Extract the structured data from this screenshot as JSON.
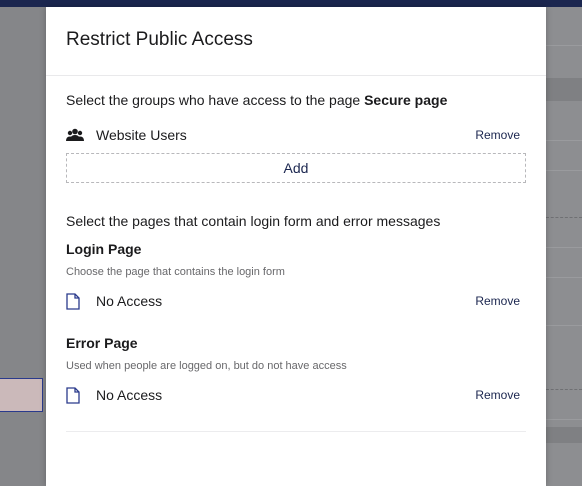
{
  "dialog": {
    "title": "Restrict Public Access",
    "groups_intro": "Select the groups who have access to the page ",
    "page_name": "Secure page",
    "groups": [
      {
        "label": "Website Users",
        "icon": "users-icon",
        "remove_label": "Remove"
      }
    ],
    "add_label": "Add",
    "pages_intro": "Select the pages that contain login form and error messages",
    "login": {
      "title": "Login Page",
      "hint": "Choose the page that contains the login form",
      "value": "No Access",
      "icon": "document-icon",
      "remove_label": "Remove"
    },
    "error": {
      "title": "Error Page",
      "hint": "Used when people are logged on, but do not have access",
      "value": "No Access",
      "icon": "document-icon",
      "remove_label": "Remove"
    }
  },
  "colors": {
    "accent": "#1b264f",
    "overlay": "#8a8b8f",
    "panel": "#ffffff"
  }
}
